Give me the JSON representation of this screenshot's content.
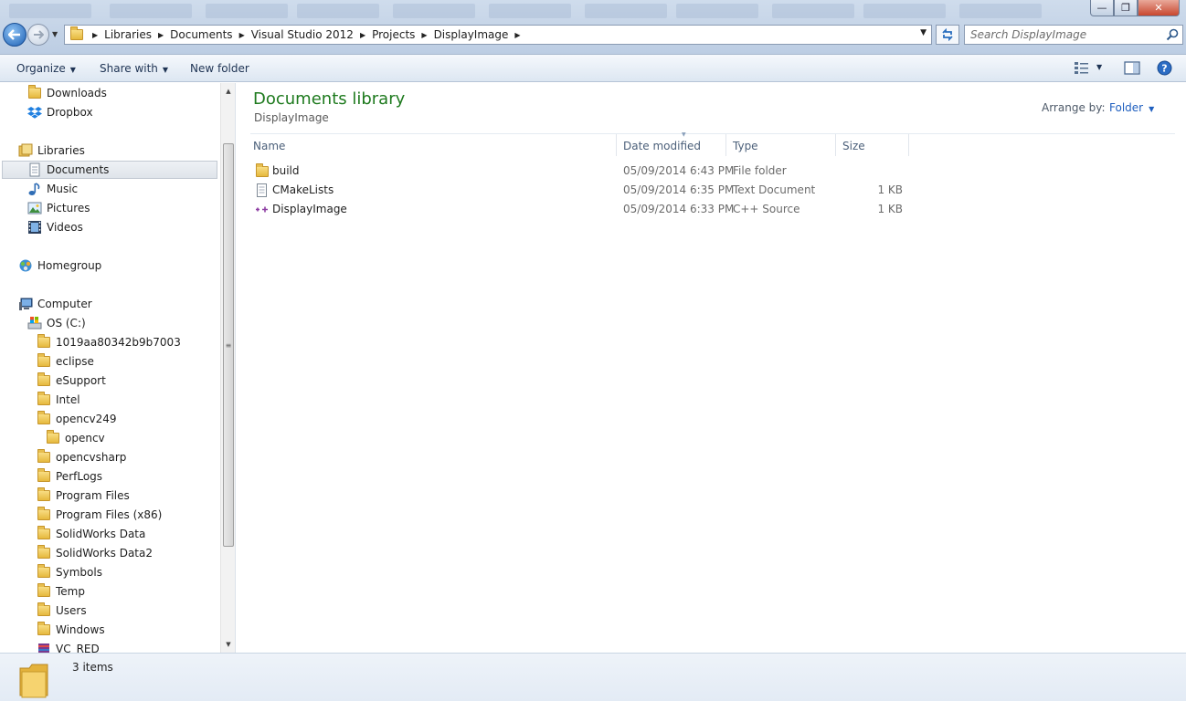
{
  "window": {
    "minimize_glyph": "—",
    "maximize_glyph": "❐",
    "close_glyph": "✕"
  },
  "address": {
    "crumbs": [
      "Libraries",
      "Documents",
      "Visual Studio 2012",
      "Projects",
      "DisplayImage"
    ]
  },
  "search": {
    "placeholder": "Search DisplayImage"
  },
  "toolbar": {
    "organize": "Organize",
    "share_with": "Share with",
    "new_folder": "New folder"
  },
  "nav": {
    "favorites": [
      {
        "label": "Downloads",
        "icon": "folder-icon"
      },
      {
        "label": "Dropbox",
        "icon": "dropbox-icon"
      }
    ],
    "libraries_label": "Libraries",
    "libraries": [
      {
        "label": "Documents",
        "icon": "documents-icon",
        "selected": true
      },
      {
        "label": "Music",
        "icon": "music-icon"
      },
      {
        "label": "Pictures",
        "icon": "pictures-icon"
      },
      {
        "label": "Videos",
        "icon": "videos-icon"
      }
    ],
    "homegroup_label": "Homegroup",
    "computer_label": "Computer",
    "drive_label": "OS (C:)",
    "drive_folders": [
      "1019aa80342b9b7003",
      "eclipse",
      "eSupport",
      "Intel",
      "opencv249",
      "opencv",
      "opencvsharp",
      "PerfLogs",
      "Program Files",
      "Program Files (x86)",
      "SolidWorks Data",
      "SolidWorks Data2",
      "Symbols",
      "Temp",
      "Users",
      "Windows",
      "VC_RED"
    ]
  },
  "library": {
    "title": "Documents library",
    "subtitle": "DisplayImage",
    "arrange_by_label": "Arrange by:",
    "arrange_by_value": "Folder"
  },
  "columns": {
    "name": "Name",
    "date_modified": "Date modified",
    "type": "Type",
    "size": "Size"
  },
  "files": [
    {
      "name": "build",
      "date": "05/09/2014 6:43 PM",
      "type": "File folder",
      "size": "",
      "icon": "folder-icon"
    },
    {
      "name": "CMakeLists",
      "date": "05/09/2014 6:35 PM",
      "type": "Text Document",
      "size": "1 KB",
      "icon": "text-document-icon"
    },
    {
      "name": "DisplayImage",
      "date": "05/09/2014 6:33 PM",
      "type": "C++ Source",
      "size": "1 KB",
      "icon": "cpp-source-icon"
    }
  ],
  "status": {
    "items_count": "3 items"
  },
  "colors": {
    "title_green": "#1e7a1e",
    "link_blue": "#1f5fbf",
    "folder_yellow": "#e6b93d"
  }
}
